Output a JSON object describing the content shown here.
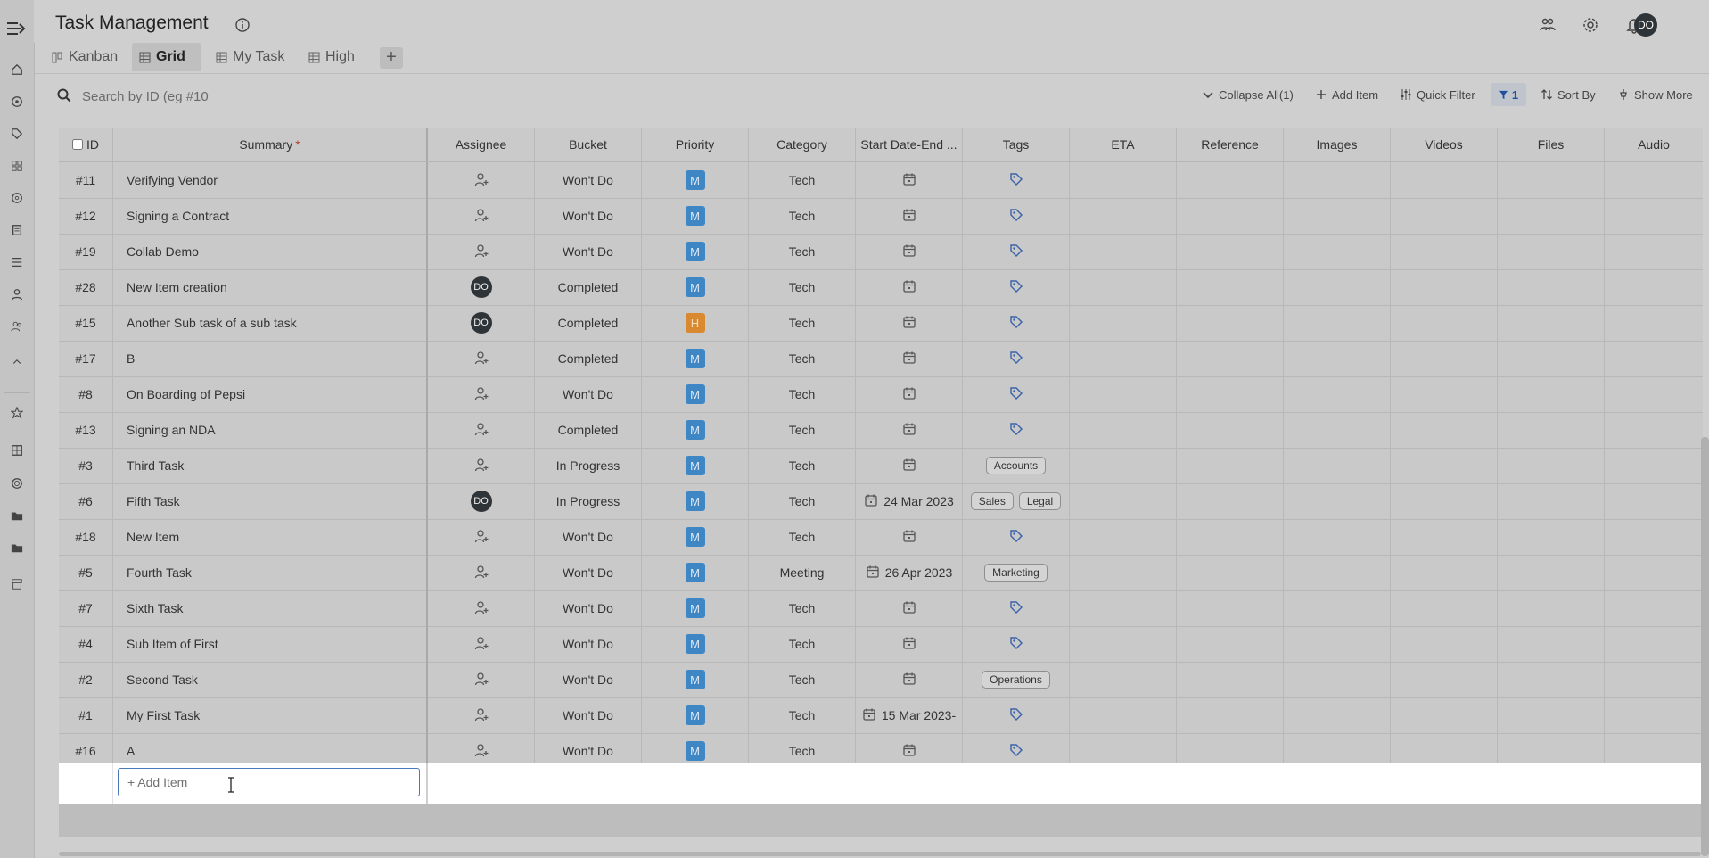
{
  "header": {
    "title": "Task Management"
  },
  "user": {
    "initials": "DO"
  },
  "tabs": [
    {
      "label": "Kanban",
      "icon": "kanban-icon",
      "active": false
    },
    {
      "label": "Grid",
      "icon": "grid-icon",
      "active": true
    },
    {
      "label": "My Task",
      "icon": "grid-icon",
      "active": false
    },
    {
      "label": "High",
      "icon": "grid-icon",
      "active": false
    }
  ],
  "add_tab": "+",
  "search": {
    "placeholder": "Search by ID (eg #10"
  },
  "toolbar": {
    "collapse_all": "Collapse All(1)",
    "add_item": "Add Item",
    "quick_filter": "Quick Filter",
    "filter_count": "1",
    "sort_by": "Sort By",
    "show_more": "Show More"
  },
  "columns": {
    "id": "ID",
    "summary": "Summary",
    "assignee": "Assignee",
    "bucket": "Bucket",
    "priority": "Priority",
    "category": "Category",
    "dates": "Start Date-End ...",
    "tags": "Tags",
    "eta": "ETA",
    "reference": "Reference",
    "images": "Images",
    "videos": "Videos",
    "files": "Files",
    "audio": "Audio"
  },
  "rows": [
    {
      "id": "#11",
      "summary": "Verifying Vendor",
      "assignee": "",
      "bucket": "Won't Do",
      "priority": "M",
      "category": "Tech",
      "date": "",
      "tags": []
    },
    {
      "id": "#12",
      "summary": "Signing a Contract",
      "assignee": "",
      "bucket": "Won't Do",
      "priority": "M",
      "category": "Tech",
      "date": "",
      "tags": []
    },
    {
      "id": "#19",
      "summary": "Collab Demo",
      "assignee": "",
      "bucket": "Won't Do",
      "priority": "M",
      "category": "Tech",
      "date": "",
      "tags": []
    },
    {
      "id": "#28",
      "summary": "New Item creation",
      "assignee": "DO",
      "bucket": "Completed",
      "priority": "M",
      "category": "Tech",
      "date": "",
      "tags": []
    },
    {
      "id": "#15",
      "summary": "Another Sub task of a sub task",
      "assignee": "DO",
      "bucket": "Completed",
      "priority": "H",
      "category": "Tech",
      "date": "",
      "tags": []
    },
    {
      "id": "#17",
      "summary": "B",
      "assignee": "",
      "bucket": "Completed",
      "priority": "M",
      "category": "Tech",
      "date": "",
      "tags": []
    },
    {
      "id": "#8",
      "summary": "On Boarding of Pepsi",
      "assignee": "",
      "bucket": "Won't Do",
      "priority": "M",
      "category": "Tech",
      "date": "",
      "tags": []
    },
    {
      "id": "#13",
      "summary": "Signing an NDA",
      "assignee": "",
      "bucket": "Completed",
      "priority": "M",
      "category": "Tech",
      "date": "",
      "tags": []
    },
    {
      "id": "#3",
      "summary": "Third Task",
      "assignee": "",
      "bucket": "In Progress",
      "priority": "M",
      "category": "Tech",
      "date": "",
      "tags": [
        "Accounts"
      ]
    },
    {
      "id": "#6",
      "summary": "Fifth Task",
      "assignee": "DO",
      "bucket": "In Progress",
      "priority": "M",
      "category": "Tech",
      "date": "24 Mar 2023",
      "tags": [
        "Sales",
        "Legal"
      ]
    },
    {
      "id": "#18",
      "summary": "New Item",
      "assignee": "",
      "bucket": "Won't Do",
      "priority": "M",
      "category": "Tech",
      "date": "",
      "tags": []
    },
    {
      "id": "#5",
      "summary": "Fourth Task",
      "assignee": "",
      "bucket": "Won't Do",
      "priority": "M",
      "category": "Meeting",
      "date": "26 Apr 2023",
      "tags": [
        "Marketing"
      ]
    },
    {
      "id": "#7",
      "summary": "Sixth Task",
      "assignee": "",
      "bucket": "Won't Do",
      "priority": "M",
      "category": "Tech",
      "date": "",
      "tags": []
    },
    {
      "id": "#4",
      "summary": "Sub Item of First",
      "assignee": "",
      "bucket": "Won't Do",
      "priority": "M",
      "category": "Tech",
      "date": "",
      "tags": []
    },
    {
      "id": "#2",
      "summary": "Second Task",
      "assignee": "",
      "bucket": "Won't Do",
      "priority": "M",
      "category": "Tech",
      "date": "",
      "tags": [
        "Operations"
      ]
    },
    {
      "id": "#1",
      "summary": "My First Task",
      "assignee": "",
      "bucket": "Won't Do",
      "priority": "M",
      "category": "Tech",
      "date": "15 Mar 2023-",
      "tags": []
    },
    {
      "id": "#16",
      "summary": "A",
      "assignee": "",
      "bucket": "Won't Do",
      "priority": "M",
      "category": "Tech",
      "date": "",
      "tags": []
    }
  ],
  "add_item_row": {
    "placeholder": "+ Add Item"
  },
  "colors": {
    "priority_medium": "#3f86c4",
    "priority_high": "#d9892f",
    "accent": "#1f4fa0"
  }
}
